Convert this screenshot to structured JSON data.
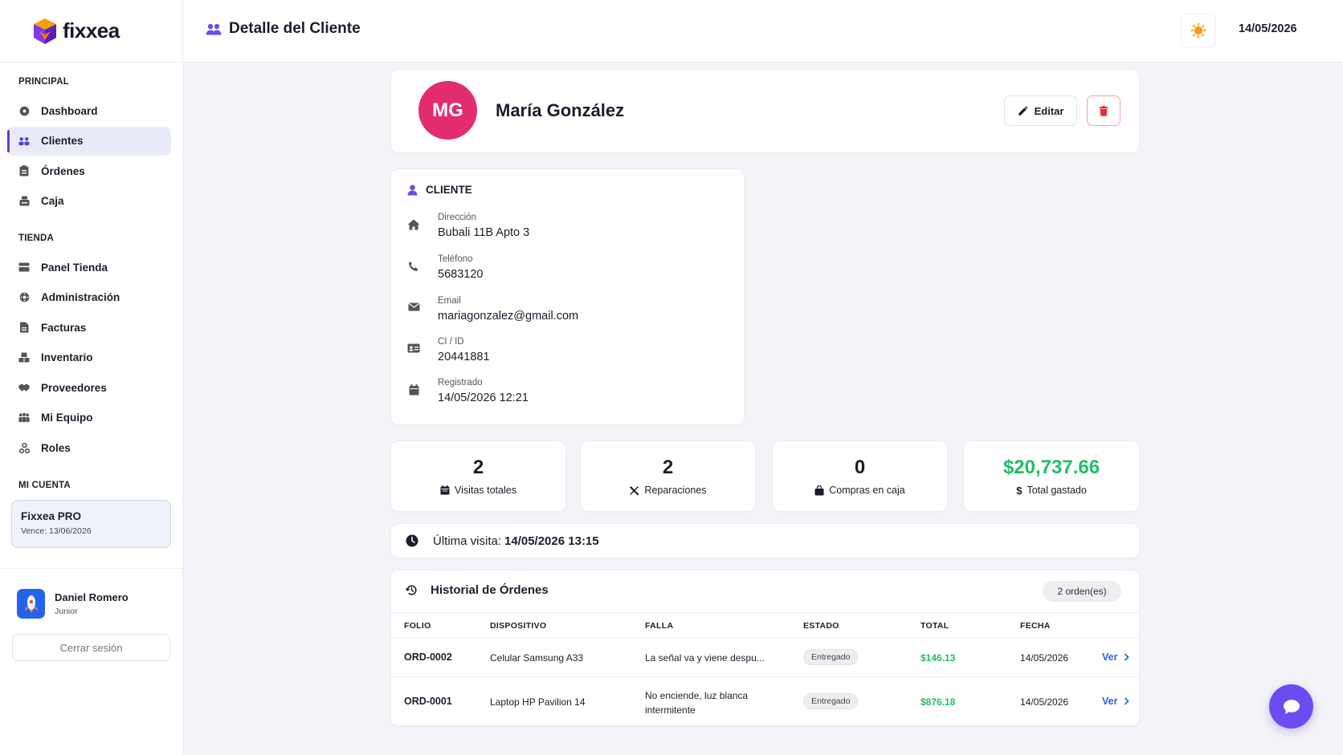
{
  "app": {
    "name": "fixxea"
  },
  "header": {
    "title": "Detalle del Cliente",
    "date": "14/05/2026"
  },
  "sidebar": {
    "sections": [
      {
        "title": "PRINCIPAL",
        "items": [
          {
            "label": "Dashboard",
            "icon": "dashboard-icon",
            "active": false
          },
          {
            "label": "Clientes",
            "icon": "users-icon",
            "active": true
          },
          {
            "label": "Órdenes",
            "icon": "clipboard-icon",
            "active": false
          },
          {
            "label": "Caja",
            "icon": "cash-register-icon",
            "active": false
          }
        ]
      },
      {
        "title": "TIENDA",
        "items": [
          {
            "label": "Panel Tienda",
            "icon": "store-icon",
            "active": false
          },
          {
            "label": "Administración",
            "icon": "settings-icon",
            "active": false
          },
          {
            "label": "Facturas",
            "icon": "invoice-icon",
            "active": false
          },
          {
            "label": "Inventario",
            "icon": "boxes-icon",
            "active": false
          },
          {
            "label": "Proveedores",
            "icon": "handshake-icon",
            "active": false
          },
          {
            "label": "Mi Equipo",
            "icon": "team-icon",
            "active": false
          },
          {
            "label": "Roles",
            "icon": "roles-icon",
            "active": false
          }
        ]
      },
      {
        "title": "MI CUENTA",
        "items": []
      }
    ],
    "plan": {
      "name": "Fixxea PRO",
      "expires": "Vence: 13/06/2026"
    },
    "user": {
      "name": "Daniel Romero",
      "role": "Junior"
    },
    "logout_label": "Cerrar sesión"
  },
  "client": {
    "initials": "MG",
    "name": "María González",
    "avatar_color": "#e32c6f",
    "edit_label": "Editar",
    "section_title": "CLIENTE",
    "fields": [
      {
        "label": "Dirección",
        "value": "Bubali 11B Apto 3",
        "icon": "home-icon"
      },
      {
        "label": "Teléfono",
        "value": "5683120",
        "icon": "phone-icon"
      },
      {
        "label": "Email",
        "value": "mariagonzalez@gmail.com",
        "icon": "mail-icon"
      },
      {
        "label": "CI / ID",
        "value": "20441881",
        "icon": "id-card-icon"
      },
      {
        "label": "Registrado",
        "value": "14/05/2026 12:21",
        "icon": "calendar-icon"
      }
    ]
  },
  "stats": [
    {
      "value": "2",
      "label": "Visitas totales",
      "icon": "calendar-check-icon"
    },
    {
      "value": "2",
      "label": "Reparaciones",
      "icon": "tools-icon"
    },
    {
      "value": "0",
      "label": "Compras en caja",
      "icon": "shopping-bag-icon"
    },
    {
      "value": "$20,737.66",
      "label": "Total gastado",
      "icon": "dollar-icon",
      "color": "#1fbf63"
    }
  ],
  "last_visit": {
    "label": "Última visita:",
    "value": "14/05/2026 13:15"
  },
  "history": {
    "title": "Historial de Órdenes",
    "count": "2 orden(es)",
    "columns": [
      "FOLIO",
      "DISPOSITIVO",
      "FALLA",
      "ESTADO",
      "TOTAL",
      "FECHA"
    ],
    "rows": [
      {
        "folio": "ORD-0002",
        "device": "Celular Samsung A33",
        "issue": "La señal va y viene despu...",
        "status": "Entregado",
        "total": "$146.13",
        "date": "14/05/2026",
        "action": "Ver"
      },
      {
        "folio": "ORD-0001",
        "device": "Laptop HP Pavilion 14",
        "issue": "No enciende, luz blanca intermitente",
        "status": "Entregado",
        "total": "$876.18",
        "date": "14/05/2026",
        "action": "Ver"
      }
    ]
  },
  "colors": {
    "accent": "#5b3fe0",
    "success": "#1fbf63",
    "link": "#2563eb",
    "danger": "#e0303a"
  }
}
